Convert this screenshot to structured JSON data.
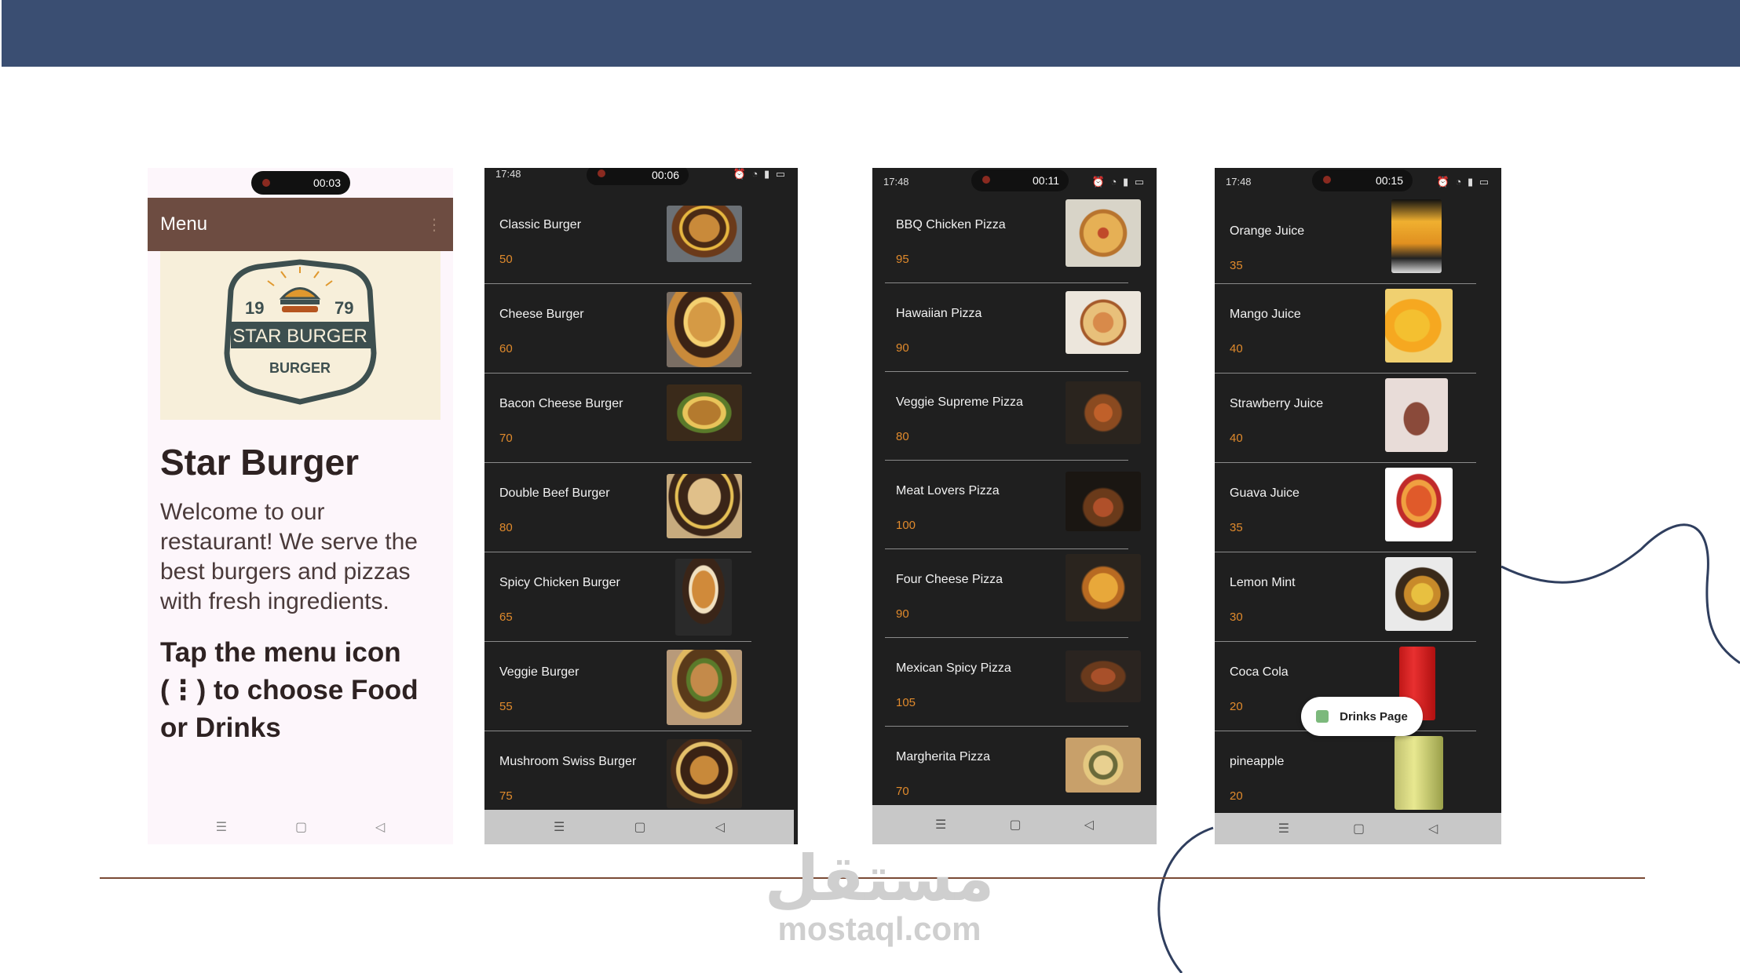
{
  "colors": {
    "topbar": "#3a4e72",
    "accent_price": "#e08a2c",
    "appbar": "#6d4c41",
    "divider": "#7a4a35"
  },
  "phone1": {
    "timer": "00:03",
    "appbar_title": "Menu",
    "logo": {
      "year_left": "19",
      "year_right": "79",
      "line1": "STAR BURGER",
      "line2": "BURGER"
    },
    "title": "Star Burger",
    "welcome": "Welcome to our restaurant! We serve the best burgers and pizzas with fresh ingredients.",
    "tap_text": "Tap the menu icon (⋮) to choose Food or Drinks",
    "nav": [
      "☰",
      "▢",
      "◁"
    ]
  },
  "phone2": {
    "time": "17:48",
    "timer": "00:06",
    "items": [
      {
        "name": "Classic Burger",
        "price": "50"
      },
      {
        "name": "Cheese Burger",
        "price": "60"
      },
      {
        "name": "Bacon Cheese Burger",
        "price": "70"
      },
      {
        "name": "Double Beef Burger",
        "price": "80"
      },
      {
        "name": "Spicy Chicken Burger",
        "price": "65"
      },
      {
        "name": "Veggie Burger",
        "price": "55"
      },
      {
        "name": "Mushroom Swiss Burger",
        "price": "75"
      }
    ],
    "nav": [
      "☰",
      "▢",
      "◁"
    ]
  },
  "phone3": {
    "time": "17:48",
    "timer": "00:11",
    "items": [
      {
        "name": "BBQ Chicken Pizza",
        "price": "95"
      },
      {
        "name": "Hawaiian Pizza",
        "price": "90"
      },
      {
        "name": "Veggie Supreme Pizza",
        "price": "80"
      },
      {
        "name": "Meat Lovers Pizza",
        "price": "100"
      },
      {
        "name": "Four Cheese Pizza",
        "price": "90"
      },
      {
        "name": "Mexican Spicy Pizza",
        "price": "105"
      },
      {
        "name": "Margherita Pizza",
        "price": "70"
      }
    ],
    "nav": [
      "☰",
      "▢",
      "◁"
    ]
  },
  "phone4": {
    "time": "17:48",
    "timer": "00:15",
    "items": [
      {
        "name": "Orange Juice",
        "price": "35"
      },
      {
        "name": "Mango Juice",
        "price": "40"
      },
      {
        "name": "Strawberry Juice",
        "price": "40"
      },
      {
        "name": "Guava Juice",
        "price": "35"
      },
      {
        "name": "Lemon Mint",
        "price": "30"
      },
      {
        "name": "Coca Cola",
        "price": "20"
      },
      {
        "name": "pineapple",
        "price": "20"
      }
    ],
    "toast": "Drinks Page",
    "nav": [
      "☰",
      "▢",
      "◁"
    ]
  },
  "watermark": {
    "arabic": "مستقل",
    "latin": "mostaql.com"
  }
}
